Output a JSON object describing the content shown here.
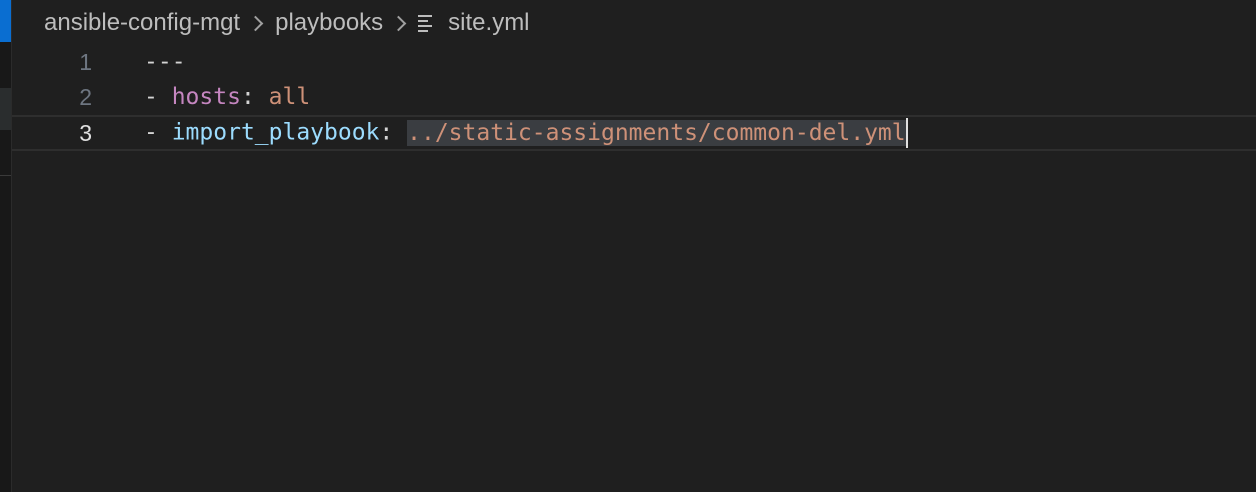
{
  "breadcrumb": {
    "items": [
      "ansible-config-mgt",
      "playbooks"
    ],
    "file": "site.yml"
  },
  "editor": {
    "lines": [
      {
        "number": "1",
        "dash": "---"
      },
      {
        "number": "2",
        "dash": "- ",
        "key": "hosts",
        "sep": ": ",
        "value": "all"
      },
      {
        "number": "3",
        "dash": "- ",
        "key": "import_playbook",
        "sep": ": ",
        "value": "../static-assignments/common-del.yml"
      }
    ],
    "current_line": "3"
  },
  "icons": {
    "file": "file-lines-icon",
    "chevron": "chevron-right-icon"
  },
  "colors": {
    "background": "#1f1f1f",
    "accent": "#0a6ed1",
    "yaml_key_purple": "#c586c0",
    "yaml_key_blue": "#9cdcfe",
    "yaml_string": "#ce9178"
  }
}
